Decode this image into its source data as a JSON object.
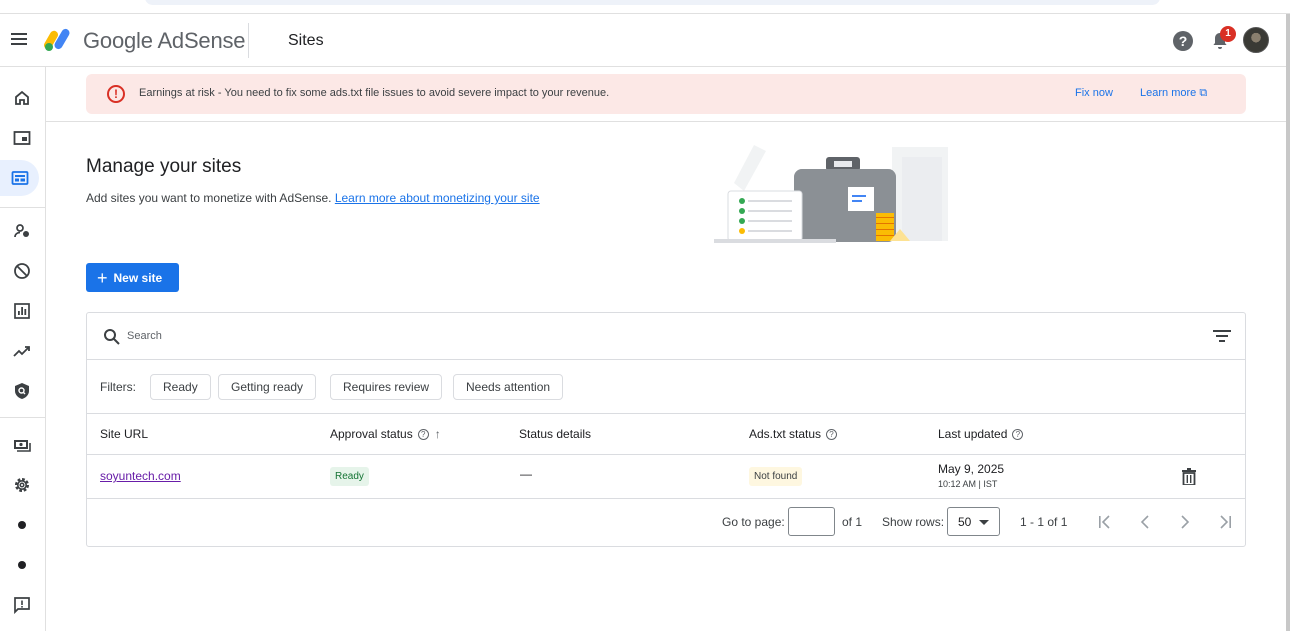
{
  "header": {
    "brand": "Google AdSense",
    "page_name": "Sites",
    "help_icon": "?",
    "notification_count": "1"
  },
  "sidebar": {
    "items": [
      {
        "icon": "home-icon"
      },
      {
        "icon": "ads-icon"
      },
      {
        "icon": "sites-icon",
        "active": true
      },
      {
        "icon": "privacy-messaging-icon"
      },
      {
        "icon": "blocking-controls-icon"
      },
      {
        "icon": "reports-icon"
      },
      {
        "icon": "optimization-icon"
      },
      {
        "icon": "policy-center-icon"
      },
      {
        "icon": "payments-icon"
      },
      {
        "icon": "settings-icon"
      },
      {
        "icon": "dot-icon"
      },
      {
        "icon": "dot-icon"
      },
      {
        "icon": "feedback-icon"
      }
    ]
  },
  "alert": {
    "icon": "!",
    "text": "Earnings at risk - You need to fix some ads.txt file issues to avoid severe impact to your revenue.",
    "fix_now": "Fix now",
    "learn_more": "Learn more",
    "learn_more_icon": "⧉",
    "color": "#fce8e6"
  },
  "intro": {
    "title": "Manage your sites",
    "subtitle": "Add sites you want to monetize with AdSense.",
    "link": "Learn more about monetizing your site"
  },
  "new_site_button": {
    "plus": "+",
    "label": "New site",
    "color": "#1a73e8"
  },
  "search": {
    "placeholder": "Search"
  },
  "filters": {
    "label": "Filters:",
    "chips": [
      "Ready",
      "Getting ready",
      "Requires review",
      "Needs attention"
    ]
  },
  "table": {
    "columns": {
      "site_url": "Site URL",
      "approval_status": "Approval status",
      "status_details": "Status details",
      "ads_txt_status": "Ads.txt status",
      "last_updated": "Last updated"
    },
    "sort_arrow": "↑",
    "help_glyph": "?",
    "rows": [
      {
        "site_url": "soyuntech.com",
        "approval_status": "Ready",
        "status_details": "—",
        "ads_txt_status": "Not found",
        "last_updated_date": "May 9, 2025",
        "last_updated_time": "10:12 AM | IST"
      }
    ]
  },
  "pagination": {
    "go_to_page_label": "Go to page:",
    "page_value": "",
    "of_label": "of 1",
    "show_rows_label": "Show rows:",
    "rows_value": "50",
    "range": "1 - 1 of 1"
  }
}
